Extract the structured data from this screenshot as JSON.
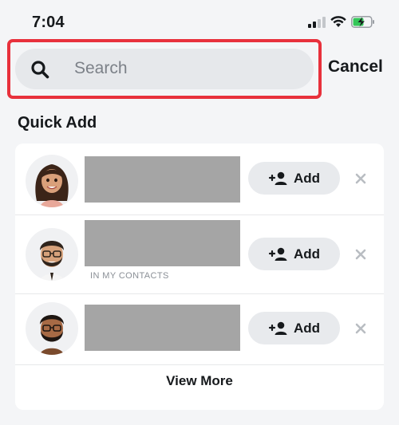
{
  "status_bar": {
    "time": "7:04"
  },
  "search": {
    "placeholder": "Search",
    "cancel_label": "Cancel"
  },
  "quick_add": {
    "title": "Quick Add",
    "items": [
      {
        "avatar": "female-bitmoji-avatar",
        "note": "",
        "add_label": "Add"
      },
      {
        "avatar": "male-bitmoji-avatar-glasses",
        "note": "IN MY CONTACTS",
        "add_label": "Add"
      },
      {
        "avatar": "male-bitmoji-avatar-beard-glasses",
        "note": "",
        "add_label": "Add"
      }
    ],
    "view_more_label": "View More"
  },
  "colors": {
    "highlight": "#e8313c",
    "background": "#f4f5f7",
    "card": "#ffffff",
    "redacted": "#a5a5a5"
  }
}
